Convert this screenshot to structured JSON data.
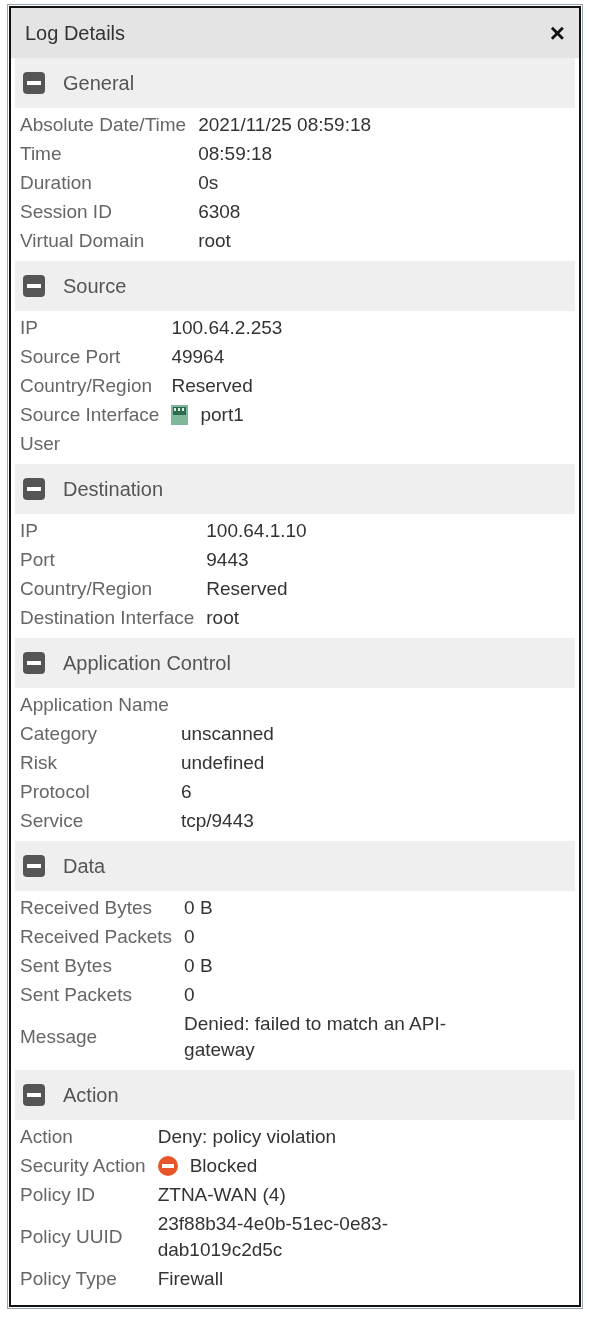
{
  "window": {
    "title": "Log Details",
    "close": "×"
  },
  "sections": [
    {
      "title": "General",
      "expanded": true,
      "rows": [
        {
          "label": "Absolute Date/Time",
          "value": "2021/11/25 08:59:18"
        },
        {
          "label": "Time",
          "value": "08:59:18"
        },
        {
          "label": "Duration",
          "value": "0s"
        },
        {
          "label": "Session ID",
          "value": "6308"
        },
        {
          "label": "Virtual Domain",
          "value": "root"
        }
      ]
    },
    {
      "title": "Source",
      "expanded": true,
      "rows": [
        {
          "label": "IP",
          "value": "100.64.2.253"
        },
        {
          "label": "Source Port",
          "value": "49964"
        },
        {
          "label": "Country/Region",
          "value": "Reserved"
        },
        {
          "label": "Source Interface",
          "value": "port1",
          "kind": "interface"
        },
        {
          "label": "User"
        }
      ]
    },
    {
      "title": "Destination",
      "expanded": true,
      "rows": [
        {
          "label": "IP",
          "value": "100.64.1.10"
        },
        {
          "label": "Port",
          "value": "9443"
        },
        {
          "label": "Country/Region",
          "value": "Reserved"
        },
        {
          "label": "Destination Interface",
          "value": "root"
        }
      ]
    },
    {
      "title": "Application Control",
      "expanded": true,
      "rows": [
        {
          "label": "Application Name"
        },
        {
          "label": "Category",
          "value": "unscanned"
        },
        {
          "label": "Risk",
          "value": "undefined"
        },
        {
          "label": "Protocol",
          "value": "6"
        },
        {
          "label": "Service",
          "value": "tcp/9443"
        }
      ]
    },
    {
      "title": "Data",
      "expanded": true,
      "rows": [
        {
          "label": "Received Bytes",
          "value": "0 B"
        },
        {
          "label": "Received Packets",
          "value": "0"
        },
        {
          "label": "Sent Bytes",
          "value": "0 B"
        },
        {
          "label": "Sent Packets",
          "value": "0"
        },
        {
          "label": "Message",
          "value": "Denied: failed to match an API-gateway"
        }
      ]
    },
    {
      "title": "Action",
      "expanded": true,
      "rows": [
        {
          "label": "Action",
          "value": "Deny: policy violation"
        },
        {
          "label": "Security Action",
          "value": "Blocked",
          "kind": "blocked"
        },
        {
          "label": "Policy ID",
          "value": "ZTNA-WAN (4)"
        },
        {
          "label": "Policy UUID",
          "value": "23f88b34-4e0b-51ec-0e83-dab1019c2d5c"
        },
        {
          "label": "Policy Type",
          "value": "Firewall"
        }
      ]
    }
  ]
}
